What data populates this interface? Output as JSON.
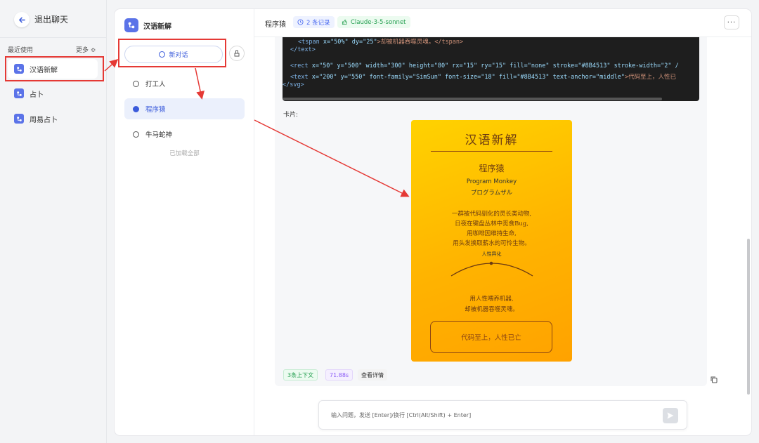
{
  "sidebar": {
    "back_label": "退出聊天",
    "recent_label": "最近使用",
    "more_label": "更多 ≎",
    "apps": [
      {
        "label": "汉语新解",
        "active": true
      },
      {
        "label": "占卜",
        "active": false
      },
      {
        "label": "周易占卜",
        "active": false
      }
    ]
  },
  "conversations": {
    "app_name": "汉语新解",
    "new_chat_label": "新对话",
    "items": [
      {
        "label": "打工人",
        "active": false
      },
      {
        "label": "程序猿",
        "active": true
      },
      {
        "label": "牛马蛇神",
        "active": false
      }
    ],
    "loaded_all": "已加载全部"
  },
  "chat": {
    "title": "程序猿",
    "records_tag": "2 条记录",
    "model_tag": "Claude-3-5-sonnet",
    "menu": "···"
  },
  "code": {
    "lines": [
      {
        "tag_open": "<tspan ",
        "attrs": "x=\"50%\" dy=\"25\"",
        "text": ">却被机器吞噬灵魂。</tspan>"
      },
      {
        "tag_open": "</text>",
        "attrs": "",
        "text": ""
      },
      {
        "tag_open": "<rect ",
        "attrs": "x=\"50\" y=\"500\" width=\"300\" height=\"80\" rx=\"15\" ry=\"15\" fill=\"none\" stroke=\"#8B4513\" stroke-width=\"2\" /",
        "text": ""
      },
      {
        "tag_open": "<text ",
        "attrs": "x=\"200\" y=\"550\" font-family=\"SimSun\" font-size=\"18\" fill=\"#8B4513\" text-anchor=\"middle\"",
        "text": ">代码至上，人性已"
      },
      {
        "tag_open": "</svg>",
        "attrs": "",
        "text": ""
      }
    ]
  },
  "card": {
    "label": "卡片:",
    "title": "汉语新解",
    "word": "程序猿",
    "english": "Program Monkey",
    "japanese": "プログラムザル",
    "definition": [
      "一群被代码驯化的灵长类动物,",
      "日夜在键盘丛林中觅食Bug,",
      "用咖啡因维持生命,",
      "用头发换取薪水的可怜生物。"
    ],
    "humanity_label": "人性异化",
    "quote": [
      "用人性喂养机器,",
      "却被机器吞噬灵魂。"
    ],
    "box_text": "代码至上，人性已亡"
  },
  "meta": {
    "context": "3条上下文",
    "time": "71.88s",
    "detail": "查看详情"
  },
  "input": {
    "placeholder": "输入问题，发送 [Enter]/换行 [Ctrl(Alt/Shift) + Enter]"
  },
  "colors": {
    "accent": "#3b5bdb",
    "annotation": "#e53935",
    "poster_brown": "#8b4513"
  }
}
